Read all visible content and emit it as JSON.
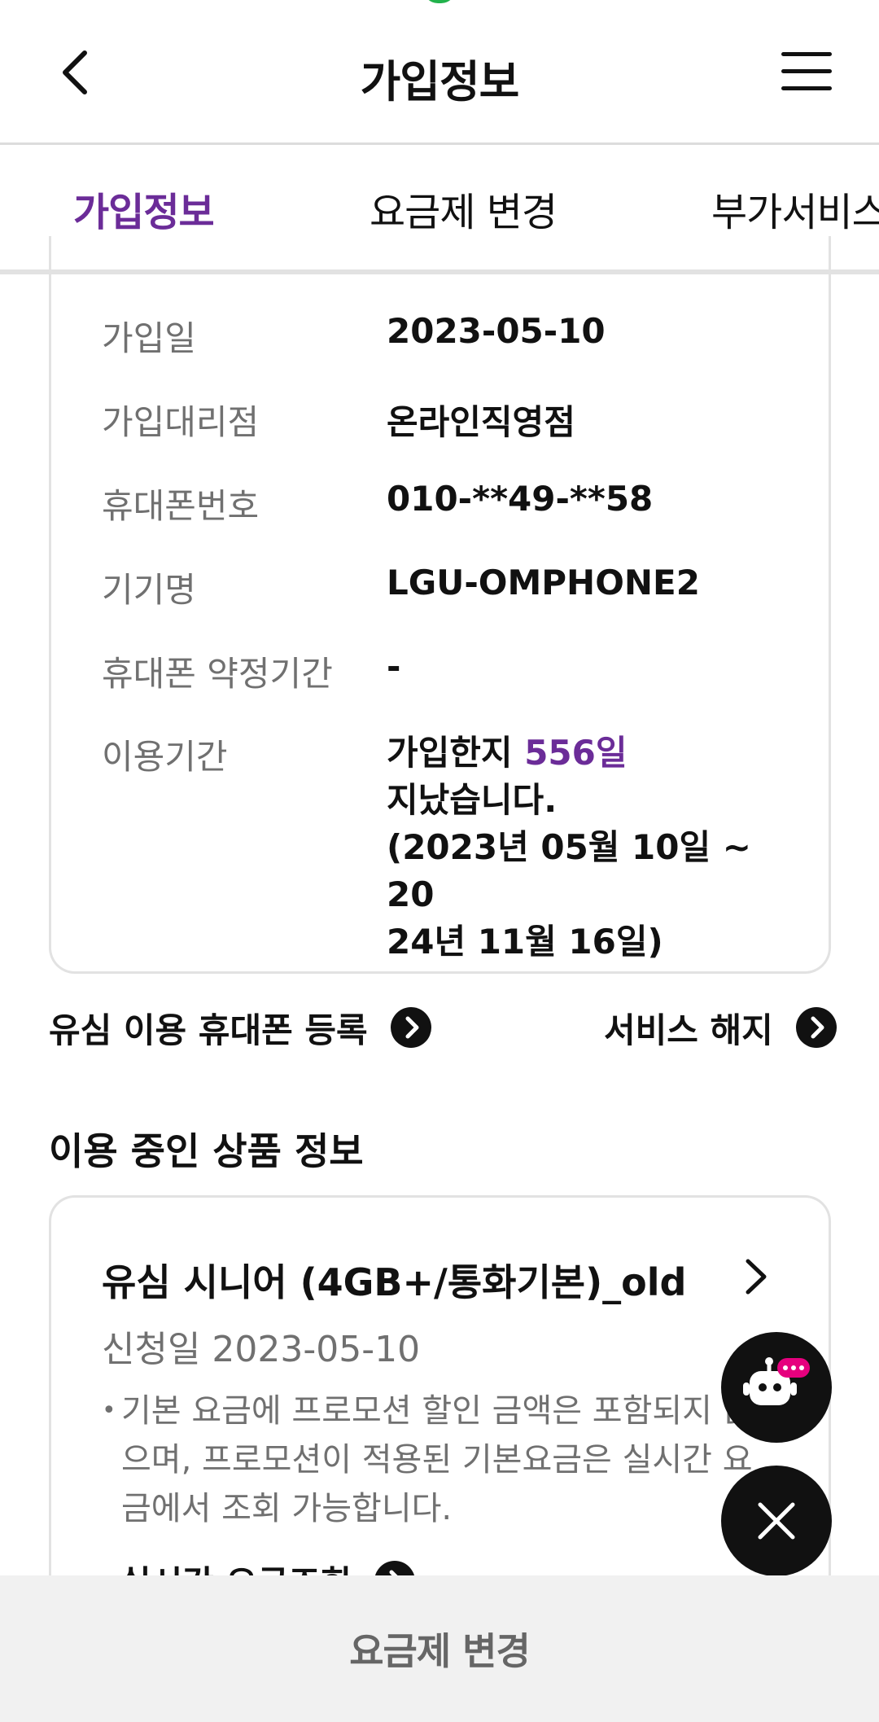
{
  "header": {
    "title": "가입정보"
  },
  "tabs": [
    {
      "label": "가입정보",
      "active": true
    },
    {
      "label": "요금제 변경",
      "active": false
    },
    {
      "label": "부가서비스",
      "active": false
    }
  ],
  "info": {
    "rows": [
      {
        "label": "가입일",
        "value": "2023-05-10"
      },
      {
        "label": "가입대리점",
        "value": "온라인직영점"
      },
      {
        "label": "휴대폰번호",
        "value": "010-**49-**58"
      },
      {
        "label": "기기명",
        "value": "LGU-OMPHONE2"
      },
      {
        "label": "휴대폰 약정기간",
        "value": "-"
      }
    ],
    "period": {
      "label": "이용기간",
      "prefix": "가입한지 ",
      "days": "556일",
      "line2": "지났습니다.",
      "line3": "(2023년 05월 10일 ~ 20",
      "line4": "24년 11월 16일)"
    }
  },
  "links": {
    "register": "유심 이용 휴대폰 등록",
    "terminate": "서비스 해지"
  },
  "product_section": {
    "title": "이용 중인 상품 정보",
    "name": "유심 시니어 (4GB+/통화기본)_old",
    "apply_date": "신청일 2023-05-10",
    "note": "기본 요금에 프로모션 할인 금액은 포함되지 않으며, 프로모션이 적용된 기본요금은 실시간 요금에서 조회 가능합니다.",
    "realtime_link": "실시간 요금조회"
  },
  "bottom": {
    "button_label": "요금제 변경"
  },
  "colors": {
    "accent": "#6b2c98",
    "bot_badge": "#e6007e"
  }
}
